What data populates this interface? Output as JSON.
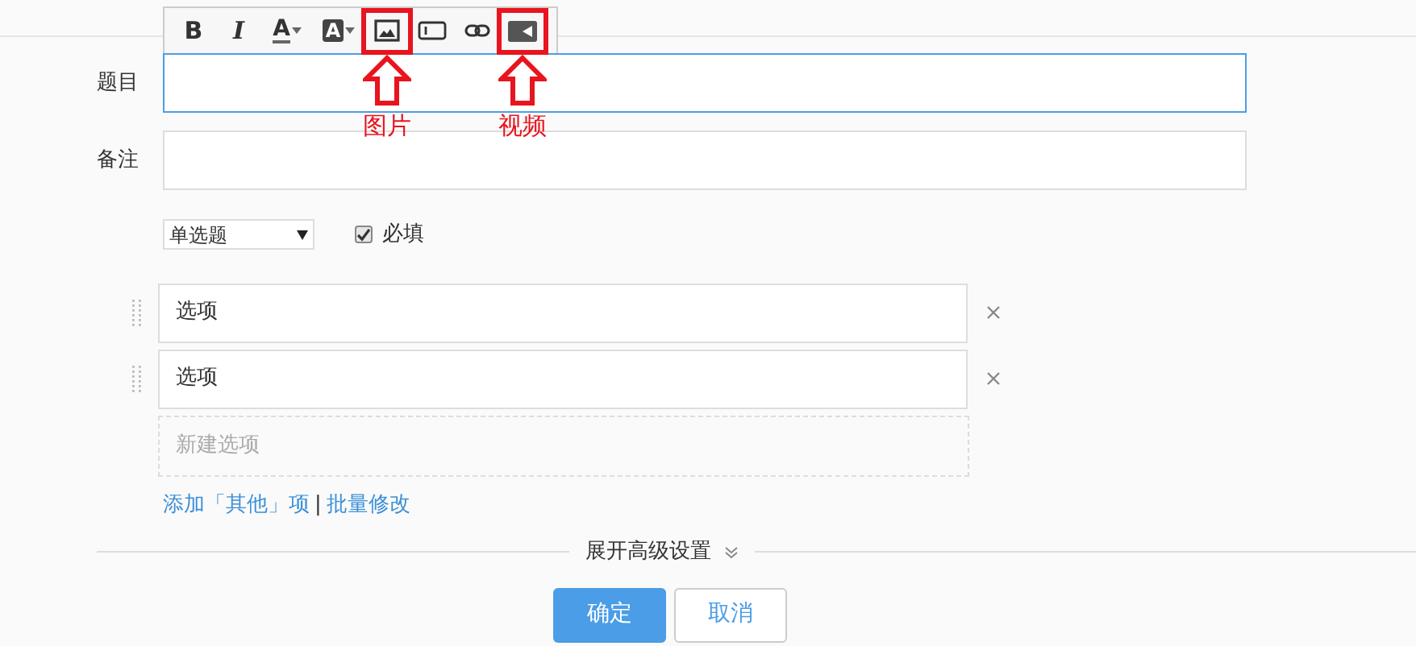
{
  "toolbar": [
    {
      "kind": "bold",
      "label": "B"
    },
    {
      "kind": "italic",
      "label": "I"
    },
    {
      "kind": "font-color",
      "label": "A"
    },
    {
      "kind": "bg-color",
      "label": "A"
    },
    {
      "kind": "image",
      "annotation": "图片"
    },
    {
      "kind": "textbox"
    },
    {
      "kind": "link"
    },
    {
      "kind": "video",
      "annotation": "视频"
    }
  ],
  "fields": [
    {
      "label": "题目",
      "focused": true
    },
    {
      "label": "备注",
      "focused": false
    }
  ],
  "question_type": {
    "value": "单选题"
  },
  "required": {
    "label": "必填",
    "checked": true
  },
  "options": [
    {
      "value": "选项"
    },
    {
      "value": "选项"
    }
  ],
  "new_option": {
    "placeholder": "新建选项"
  },
  "links": [
    {
      "label": "添加「其他」项"
    },
    {
      "label": "批量修改"
    }
  ],
  "link_separator": "|",
  "advanced": {
    "label": "展开高级设置"
  },
  "buttons": [
    {
      "label": "确定",
      "kind": "primary"
    },
    {
      "label": "取消",
      "kind": "secondary"
    }
  ]
}
